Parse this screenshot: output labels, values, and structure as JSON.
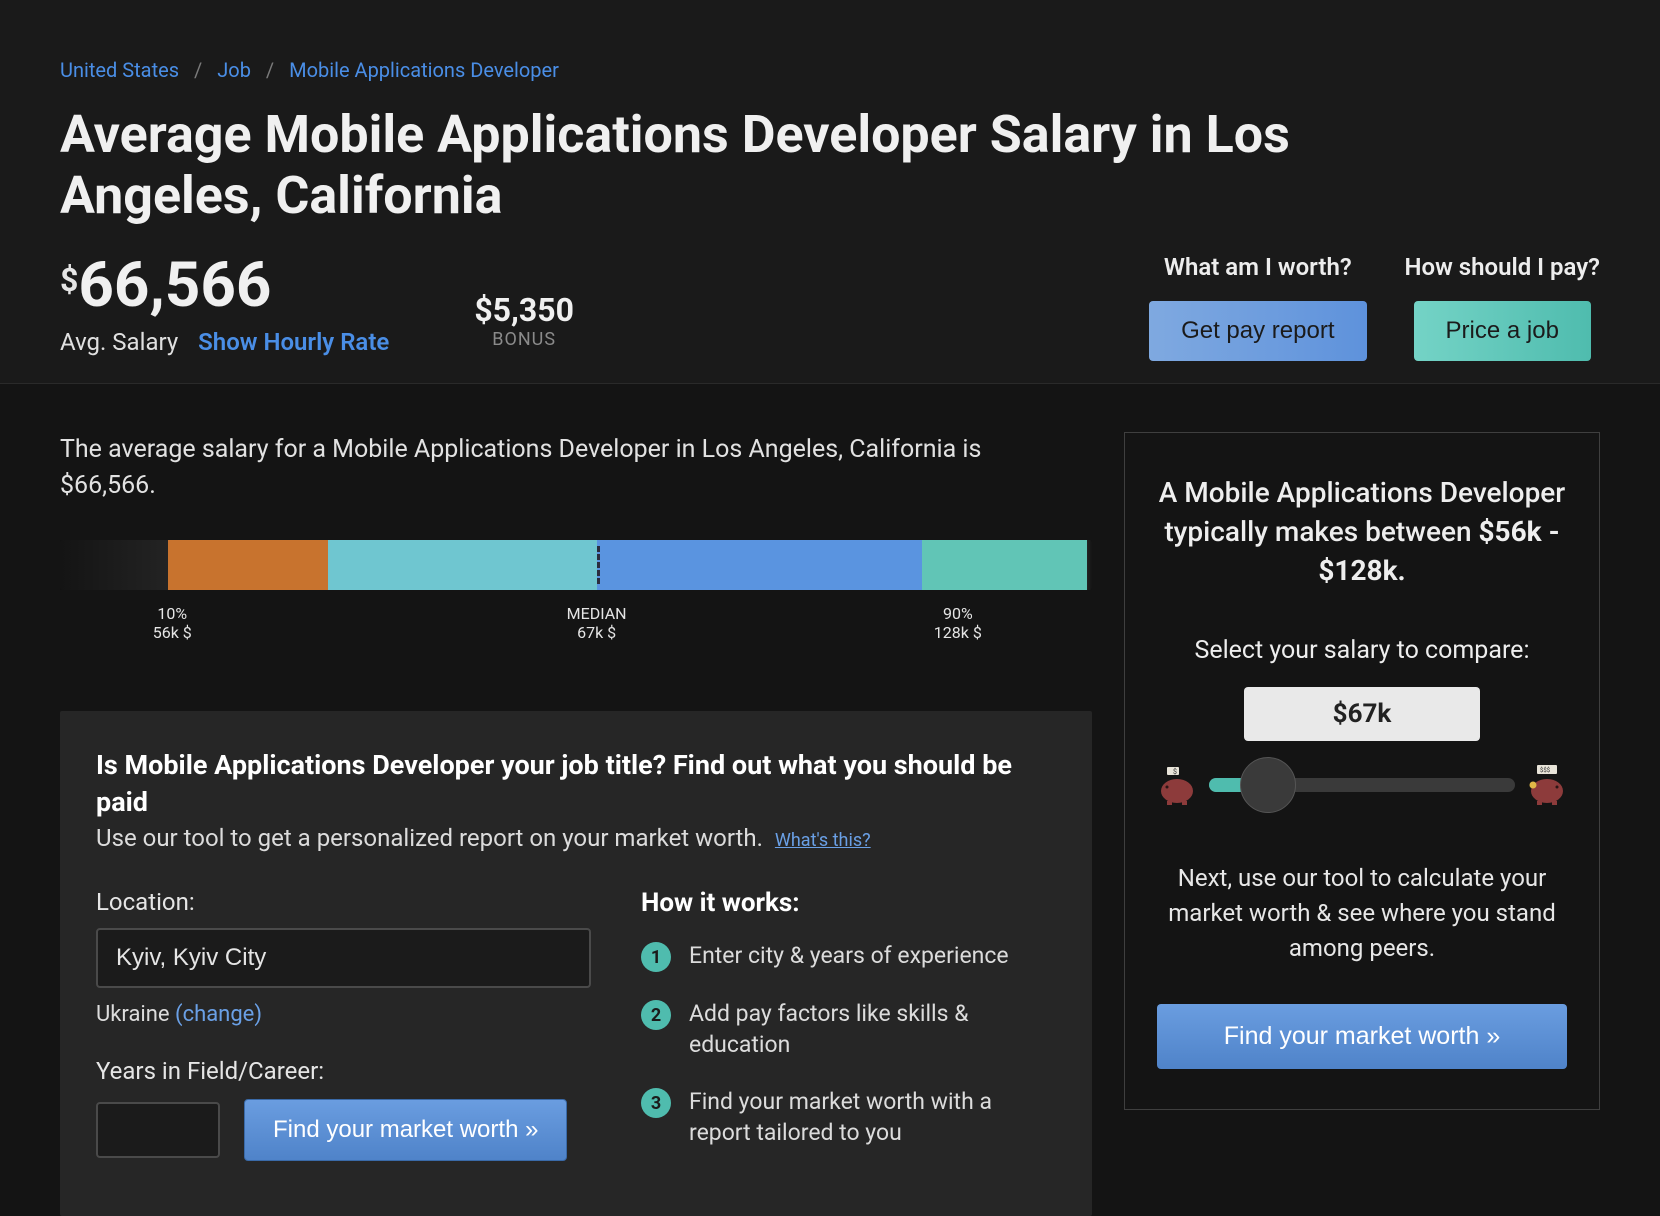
{
  "breadcrumb": {
    "country": "United States",
    "section": "Job",
    "job": "Mobile Applications Developer"
  },
  "title": "Average Mobile Applications Developer Salary in Los Angeles, California",
  "salary": {
    "currency": "$",
    "amount": "66,566",
    "avg_label": "Avg. Salary",
    "hourly_link": "Show Hourly Rate"
  },
  "bonus": {
    "amount": "$5,350",
    "label": "BONUS"
  },
  "cta": {
    "worth_q": "What am I worth?",
    "worth_btn": "Get pay report",
    "pay_q": "How should I pay?",
    "pay_btn": "Price a job"
  },
  "summary": "The average salary for a Mobile Applications Developer in Los Angeles, California is $66,566.",
  "chart_data": {
    "type": "bar",
    "percentiles": {
      "p10": {
        "label": "10%",
        "value": "56k $"
      },
      "median": {
        "label": "MEDIAN",
        "value": "67k $"
      },
      "p90": {
        "label": "90%",
        "value": "128k $"
      }
    }
  },
  "tool": {
    "heading": "Is Mobile Applications Developer your job title? Find out what you should be paid",
    "sub": "Use our tool to get a personalized report on your market worth.",
    "whats_this": "What's this?",
    "location_label": "Location:",
    "location_value": "Kyiv, Kyiv City",
    "country": "Ukraine",
    "change": "(change)",
    "years_label": "Years in Field/Career:",
    "find_btn": "Find your market worth »",
    "hiw_title": "How it works:",
    "steps": [
      "Enter city & years of experience",
      "Add pay factors like skills & education",
      "Find your market worth with a report tailored to you"
    ]
  },
  "sidebar": {
    "headline_pre": "A Mobile Applications Developer typically makes between ",
    "headline_range": "$56k - $128k.",
    "select_label": "Select your salary to compare:",
    "pill_value": "$67k",
    "next_text": "Next, use our tool to calculate your market worth & see where you stand among peers.",
    "find_btn": "Find your market worth »"
  }
}
